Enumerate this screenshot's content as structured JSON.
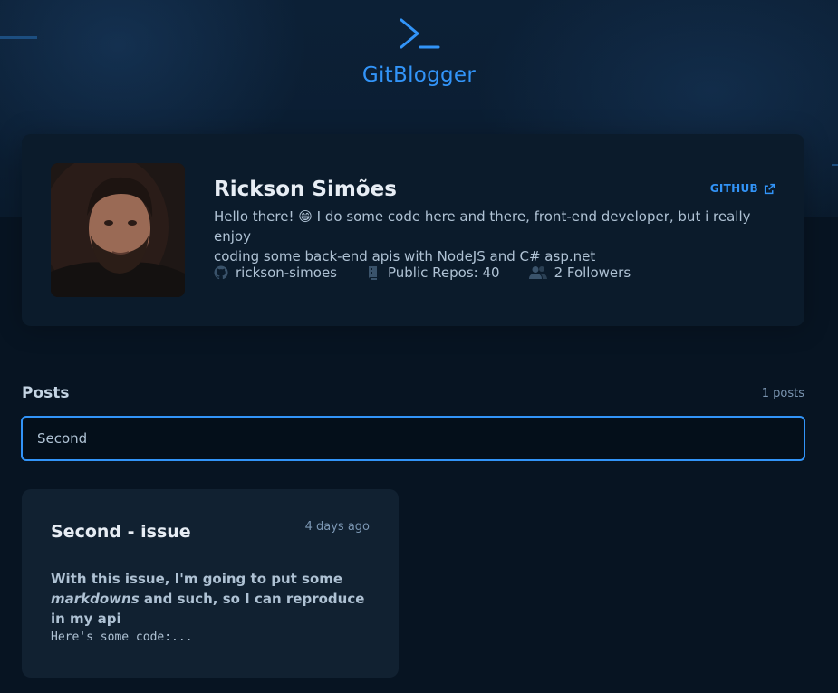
{
  "header": {
    "logo_icon": "terminal-prompt-icon",
    "title": "GitBlogger"
  },
  "profile": {
    "name": "Rickson Simões",
    "github_link_label": "GITHUB",
    "github_link_icon": "external-link-icon",
    "bio_line1": "Hello there! 😁 I do some code here and there, front-end developer, but i really enjoy",
    "bio_line2": "coding some back-end apis with NodeJS and C# asp.net",
    "stats": {
      "username": "rickson-simoes",
      "repos": "Public Repos: 40",
      "followers": "2 Followers"
    }
  },
  "posts": {
    "title": "Posts",
    "count": "1 posts",
    "search_value": "Second",
    "items": [
      {
        "title": "Second - issue",
        "date": "4 days ago",
        "excerpt_part1": "With this issue, I'm going to put some",
        "excerpt_em": "markdowns",
        "excerpt_part2": " and such, so I can reproduce in my api",
        "code": "Here's some code:..."
      }
    ]
  },
  "colors": {
    "accent": "#3294f8",
    "background": "#071422",
    "profile_bg": "#0b1b2b",
    "card_bg": "#112131"
  }
}
